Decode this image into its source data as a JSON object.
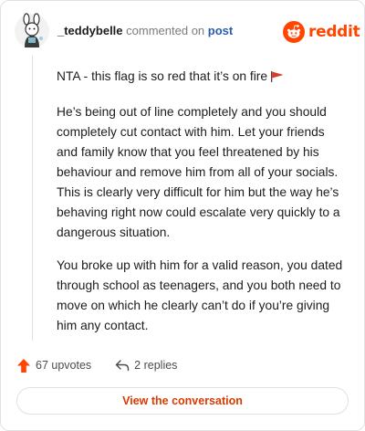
{
  "header": {
    "username": "_teddybelle",
    "action_text": "commented on",
    "post_link": "post",
    "brand": "reddit"
  },
  "comment": {
    "paragraphs": [
      "NTA - this flag is so red that it’s on fire",
      "He’s being out of line completely and you should completely cut contact with him. Let your friends and family know that you feel threatened by his behaviour and remove him from all of your socials. This is clearly very difficult for him but the way he’s behaving right now could escalate very quickly to a dangerous situation.",
      "You broke up with him for a valid reason, you dated through school as teenagers, and you both need to move on which he clearly can’t do if you’re giving him any contact."
    ]
  },
  "footer": {
    "upvotes": "67 upvotes",
    "replies": "2 replies",
    "view_button": "View the conversation"
  },
  "colors": {
    "brand": "#ff4500",
    "link": "#2a5db0",
    "cta": "#d93a00"
  }
}
